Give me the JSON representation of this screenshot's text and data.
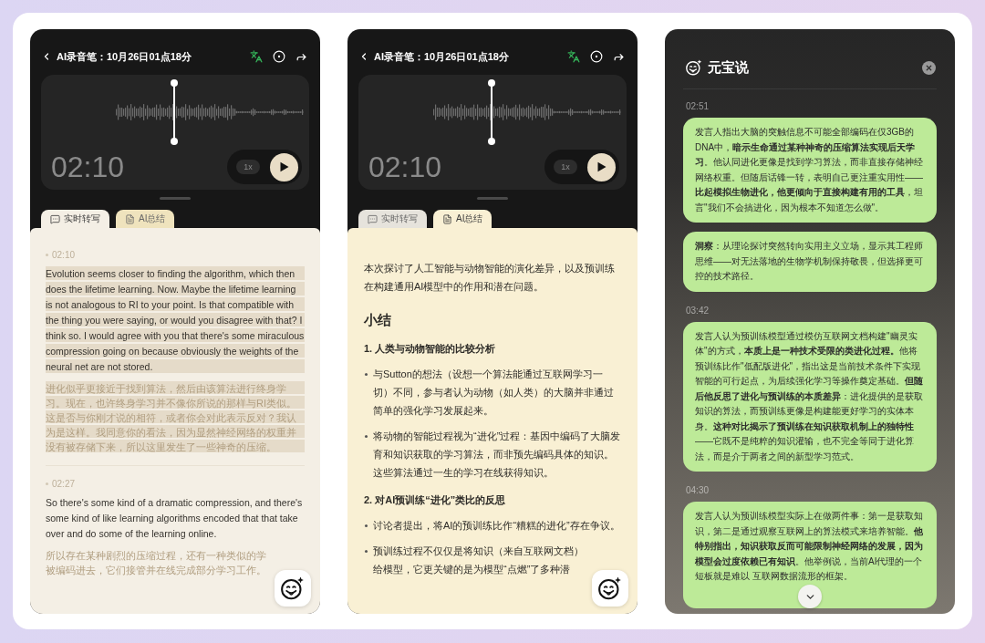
{
  "screens": [
    {
      "kind": "recorder",
      "title": "AI录音笔：10月26日01点18分",
      "player": {
        "time": "02:10",
        "speed": "1x"
      },
      "tabs": [
        {
          "kind": "transcript",
          "label": "实时转写",
          "selected": true
        },
        {
          "kind": "summary",
          "label": "AI总结",
          "selected": false
        }
      ],
      "transcript": [
        {
          "time": "02:10",
          "text": "Evolution seems closer to finding the algorithm, which then does the lifetime learning. Now. Maybe the lifetime learning is not analogous to RI to your point. Is that compatible with the thing you were saying, or would you disagree with that? I think so. I would agree with you that there's some miraculous compression going on because obviously the weights of the neural net are not stored.",
          "translation": "进化似乎更接近于找到算法，然后由该算法进行终身学习。现在，也许终身学习并不像你所说的那样与RI类似。这是否与你刚才说的相符，或者你会对此表示反对？我认为是这样。我同意你的看法，因为显然神经网络的权重并没有被存储下来，所以这里发生了一些神奇的压缩。",
          "highlighted": true
        },
        {
          "time": "02:27",
          "text": "So there's some kind of a dramatic compression, and there's some kind of like learning algorithms encoded that that take over and do some of the learning online.",
          "translation": "所以存在某种剧烈的压缩过程，还有一种类似的学被编码进去，它们接管并在线完成部分学习工作。",
          "highlighted": false
        }
      ]
    },
    {
      "kind": "recorder",
      "title": "AI录音笔：10月26日01点18分",
      "player": {
        "time": "02:10",
        "speed": "1x"
      },
      "tabs": [
        {
          "kind": "transcript",
          "label": "实时转写",
          "selected": false
        },
        {
          "kind": "summary",
          "label": "AI总结",
          "selected": true
        }
      ],
      "summary": {
        "intro": "本次探讨了人工智能与动物智能的演化差异，以及预训练在构建通用AI模型中的作用和潜在问题。",
        "heading": "小结",
        "sections": [
          {
            "title": "1. 人类与动物智能的比较分析",
            "bullets": [
              "与Sutton的想法（设想一个算法能通过互联网学习一切）不同，参与者认为动物（如人类）的大脑并非通过简单的强化学习发展起来。",
              "将动物的智能过程视为“进化”过程：基因中编码了大脑发育和知识获取的学习算法，而非预先编码具体的知识。这些算法通过一生的学习在线获得知识。"
            ]
          },
          {
            "title": "2. 对AI预训练“进化”类比的反思",
            "bullets": [
              "讨论者提出，将AI的预训练比作“糟糕的进化”存在争议。",
              "预训练过程不仅仅是将知识（来自互联网文档）给模型，它更关键的是为模型“点燃”了多种潜"
            ]
          }
        ]
      }
    },
    {
      "kind": "assistant",
      "title": "元宝说",
      "entries": [
        {
          "time": "02:51",
          "cards": [
            "发言人指出大脑的突触信息不可能全部编码在仅3GB的DNA中，**暗示生命通过某种神奇的压缩算法实现后天学习**。他认同进化更像是找到学习算法，而非直接存储神经网络权重。但随后话锋一转，表明自己更注重实用性——**比起模拟生物进化，他更倾向于直接构建有用的工具**，坦言\"我们不会搞进化，因为根本不知道怎么做\"。",
            "**洞察**：从理论探讨突然转向实用主义立场，显示其工程师思维——对无法落地的生物学机制保持敬畏，但选择更可控的技术路径。"
          ]
        },
        {
          "time": "03:42",
          "cards": [
            "发言人认为预训练模型通过模仿互联网文档构建\"幽灵实体\"的方式，**本质上是一种技术受限的类进化过程。**他将预训练比作\"低配版进化\"，指出这是当前技术条件下实现智能的可行起点，为后续强化学习等操作奠定基础。**但随后他反思了进化与预训练的本质差异**：进化提供的是获取知识的算法，而预训练更像是构建能更好学习的实体本身。**这种对比揭示了预训练在知识获取机制上的独特性**——它既不是纯粹的知识灌输，也不完全等同于进化算法，而是介于两者之间的新型学习范式。"
          ]
        },
        {
          "time": "04:30",
          "cards": [
            "发言人认为预训练模型实际上在做两件事：第一是获取知识，第二是通过观察互联网上的算法模式来培养智能。**他特别指出，知识获取反而可能限制神经网络的发展，因为模型会过度依赖已有知识**。他举例说，当前AI代理的一个短板就是难以 互联网数据流形的框架。"
          ]
        }
      ]
    }
  ]
}
